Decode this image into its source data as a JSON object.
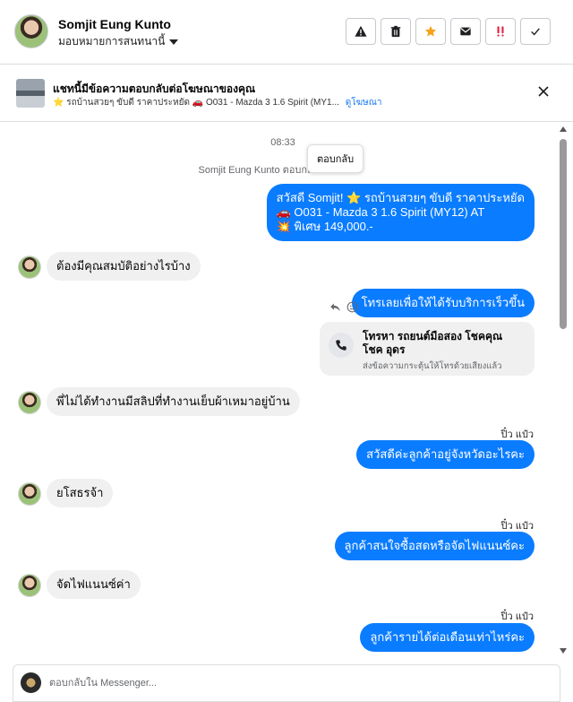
{
  "header": {
    "contact_name": "Somjit Eung Kunto",
    "assign_label": "มอบหมายการสนทนานี้",
    "actions": [
      "warning-icon",
      "trash-icon",
      "star-icon",
      "mail-icon",
      "priority-icon",
      "check-icon"
    ],
    "star_color": "#f7a21b",
    "priority_color": "#e41e3f"
  },
  "ad_banner": {
    "title": "แชทนี้มีข้อความตอบกลับต่อโฆษณาของคุณ",
    "subtitle": "⭐ รถบ้านสวยๆ ขับดี ราคาประหยัด 🚗 O031 - Mazda 3 1.6 Spirit (MY1...",
    "link": "ดูโฆษณา"
  },
  "thread": {
    "time": "08:33",
    "reply_note": "Somjit Eung Kunto ตอบกลับโฆษณา",
    "first_message": {
      "line1": "สวัสดี Somjit! ⭐ รถบ้านสวยๆ ขับดี ราคาประหยัด",
      "line2": "🚗 O031 - Mazda 3 1.6 Spirit (MY12) AT",
      "line3": "💥 พิเศษ 149,000.-"
    },
    "incoming_1": "ต้องมีคุณสมบัติอย่างไรบ้าง",
    "tooltip": "ตอบกลับ",
    "outgoing_1": "โทรเลยเพื่อให้ได้รับบริการเร็วขึ้น",
    "call_card": {
      "title": "โทรหา รถยนต์มือสอง โชคคุณ โชค อุดร",
      "subtitle": "ส่งข้อความกระตุ้นให้โทรด้วยเสียงแล้ว"
    },
    "incoming_2": "พี่ไม่ได้ทำงานมีสลิปที่ทำงานเย็บผ้าเหมาอยู่บ้าน",
    "sender_1": "ปิ๋ว แป๋ว",
    "outgoing_2": "สวัสดีค่ะลูกค้าอยู่จังหวัดอะไรคะ",
    "incoming_3": "ยโสธรจ้า",
    "sender_2": "ปิ๋ว แป๋ว",
    "outgoing_3": "ลูกค้าสนใจซื้อสดหรือจัดไฟแนนซ์คะ",
    "incoming_4": "จัดไฟแนนซ์ค่า",
    "sender_3": "ปิ๋ว แป๋ว",
    "outgoing_4": "ลูกค้ารายได้ต่อเดือนเท่าไหร่คะ"
  },
  "composer": {
    "placeholder": "ตอบกลับใน Messenger..."
  },
  "colors": {
    "outgoing_bubble": "#0a7cff",
    "incoming_bubble": "#f0f0f0",
    "link": "#1877f2"
  }
}
